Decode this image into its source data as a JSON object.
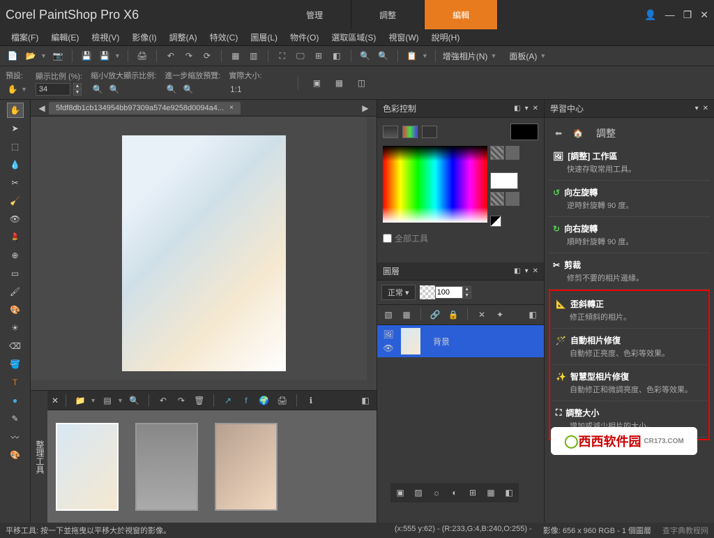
{
  "app_title": "Corel PaintShop Pro X6",
  "main_tabs": [
    "管理",
    "調整",
    "編輯"
  ],
  "main_tab_active": 2,
  "menu": [
    {
      "label": "檔案(F)"
    },
    {
      "label": "編輯(E)"
    },
    {
      "label": "檢視(V)"
    },
    {
      "label": "影像(I)"
    },
    {
      "label": "調整(A)"
    },
    {
      "label": "特效(C)"
    },
    {
      "label": "圖層(L)"
    },
    {
      "label": "物件(O)"
    },
    {
      "label": "選取區域(S)"
    },
    {
      "label": "視窗(W)"
    },
    {
      "label": "說明(H)"
    }
  ],
  "toolbar_labels": {
    "enhance": "增強相片(N)",
    "panel": "面板(A)"
  },
  "options": {
    "presets": "預設:",
    "zoom_pct": "顯示比例 (%):",
    "zoom_val": "34",
    "zoom_ratio": "縮小/放大顯示比例:",
    "step": "進一步縮放預覽:",
    "actual": "實際大小:",
    "actual_val": "1:1"
  },
  "file_tab": "5fdf8db1cb134954bb97309a574e9258d0094a4...",
  "file_close": "×",
  "organizer_label": "整理工具",
  "panels": {
    "color": {
      "title": "色彩控制",
      "all_tools": "全部工具"
    },
    "layers": {
      "title": "圖層",
      "blend": "正常",
      "opacity": "100",
      "layer_name": "背景"
    },
    "learning": {
      "title": "學習中心",
      "nav_title": "調整"
    }
  },
  "learning_items": [
    {
      "title": "[調整] 工作區",
      "desc": "快速存取常用工具。"
    },
    {
      "title": "向左旋轉",
      "desc": "逆時針旋轉 90 度。"
    },
    {
      "title": "向右旋轉",
      "desc": "順時針旋轉 90 度。"
    },
    {
      "title": "剪裁",
      "desc": "修剪不要的相片邊緣。"
    },
    {
      "title": "歪斜轉正",
      "desc": "修正傾斜的相片。"
    },
    {
      "title": "自動相片修復",
      "desc": "自動修正亮度、色彩等效果。"
    },
    {
      "title": "智慧型相片修復",
      "desc": "自動修正和微調亮度、色彩等效果。"
    },
    {
      "title": "調整大小",
      "desc": "增加或減少相片的大小。"
    }
  ],
  "status": {
    "hint": "平移工具: 按一下並拖曳以平移大於視窗的影像。",
    "coords": "(x:555 y:62) - (R:233,G:4,B:240,O:255) -",
    "img_info": "影像:  656 x 960 RGB - 1 個圖層",
    "brand": "查字典教程网"
  },
  "watermark": {
    "text": "西西软件园",
    "domain": "CR173.COM"
  }
}
